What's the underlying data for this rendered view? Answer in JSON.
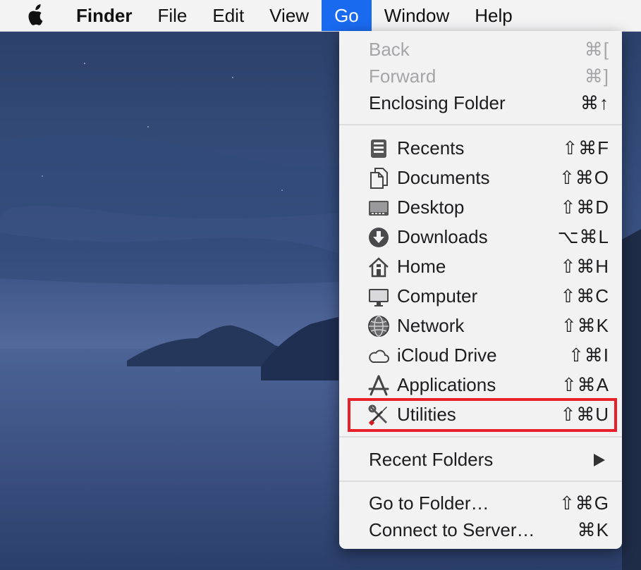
{
  "menubar": {
    "app_name": "Finder",
    "items": [
      "File",
      "Edit",
      "View",
      "Go",
      "Window",
      "Help"
    ]
  },
  "go_menu": {
    "nav": [
      {
        "label": "Back",
        "shortcut": "⌘[",
        "enabled": false
      },
      {
        "label": "Forward",
        "shortcut": "⌘]",
        "enabled": false
      },
      {
        "label": "Enclosing Folder",
        "shortcut": "⌘↑",
        "enabled": true
      }
    ],
    "places": [
      {
        "label": "Recents",
        "shortcut": "⇧⌘F",
        "icon": "recents-icon"
      },
      {
        "label": "Documents",
        "shortcut": "⇧⌘O",
        "icon": "documents-icon"
      },
      {
        "label": "Desktop",
        "shortcut": "⇧⌘D",
        "icon": "desktop-icon"
      },
      {
        "label": "Downloads",
        "shortcut": "⌥⌘L",
        "icon": "downloads-icon"
      },
      {
        "label": "Home",
        "shortcut": "⇧⌘H",
        "icon": "home-icon"
      },
      {
        "label": "Computer",
        "shortcut": "⇧⌘C",
        "icon": "computer-icon"
      },
      {
        "label": "Network",
        "shortcut": "⇧⌘K",
        "icon": "network-icon"
      },
      {
        "label": "iCloud Drive",
        "shortcut": "⇧⌘I",
        "icon": "cloud-icon"
      },
      {
        "label": "Applications",
        "shortcut": "⇧⌘A",
        "icon": "applications-icon"
      },
      {
        "label": "Utilities",
        "shortcut": "⇧⌘U",
        "icon": "utilities-icon"
      }
    ],
    "recent_folders": {
      "label": "Recent Folders"
    },
    "server": [
      {
        "label": "Go to Folder…",
        "shortcut": "⇧⌘G"
      },
      {
        "label": "Connect to Server…",
        "shortcut": "⌘K"
      }
    ]
  },
  "colors": {
    "highlight": "#e8202a",
    "menu_active": "#1a6af0"
  }
}
